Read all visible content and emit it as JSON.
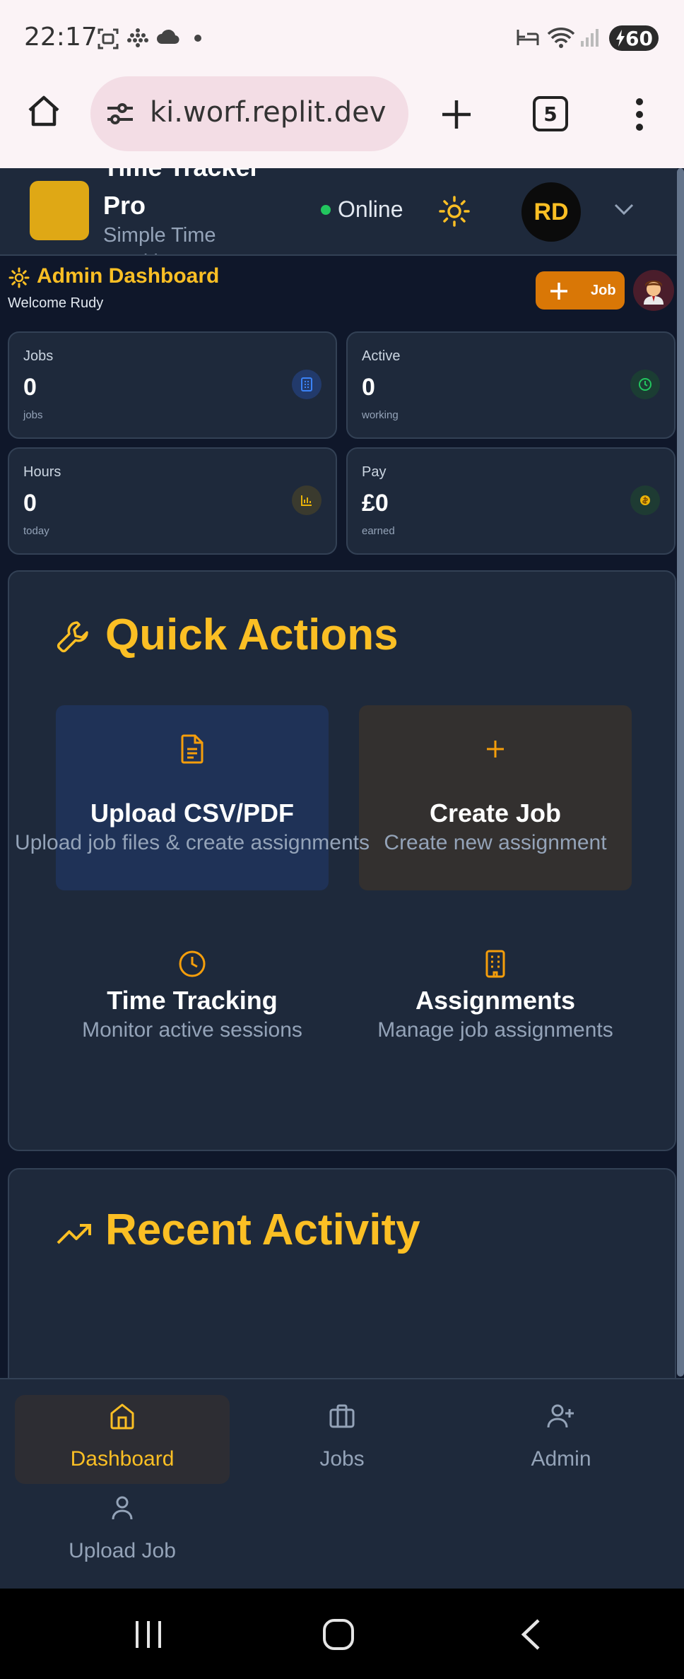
{
  "status_bar": {
    "time": "22:17",
    "battery": "60"
  },
  "browser": {
    "url": "ki.worf.replit.dev",
    "tab_count": "5"
  },
  "header": {
    "brand_title": "Time Tracker Pro",
    "brand_subtitle": "Simple Time Tracking",
    "status": "Online",
    "user_initials": "RD"
  },
  "dashboard": {
    "title": "Admin Dashboard",
    "welcome": "Welcome Rudy",
    "job_button": "Job"
  },
  "stats": [
    {
      "label": "Jobs",
      "value": "0",
      "unit": "jobs",
      "icon": "building-icon",
      "color": "#3b82f6"
    },
    {
      "label": "Active",
      "value": "0",
      "unit": "working",
      "icon": "clock-icon",
      "color": "#22c55e"
    },
    {
      "label": "Hours",
      "value": "0",
      "unit": "today",
      "icon": "bar-chart-icon",
      "color": "#eab308"
    },
    {
      "label": "Pay",
      "value": "£0",
      "unit": "earned",
      "icon": "coin-icon",
      "color": "#eab308"
    }
  ],
  "quick_actions": {
    "title": "Quick Actions",
    "items": [
      {
        "title": "Upload CSV/PDF",
        "desc": "Upload job files & create assignments",
        "icon": "file-icon"
      },
      {
        "title": "Create Job",
        "desc": "Create new assignment",
        "icon": "plus-icon"
      },
      {
        "title": "Time Tracking",
        "desc": "Monitor active sessions",
        "icon": "clock-icon"
      },
      {
        "title": "Assignments",
        "desc": "Manage job assignments",
        "icon": "building-icon"
      }
    ]
  },
  "recent_activity": {
    "title": "Recent Activity"
  },
  "bottom_nav": [
    {
      "label": "Dashboard",
      "icon": "home-icon",
      "active": true
    },
    {
      "label": "Jobs",
      "icon": "briefcase-icon",
      "active": false
    },
    {
      "label": "Admin",
      "icon": "user-plus-icon",
      "active": false
    },
    {
      "label": "Upload Job",
      "icon": "user-icon",
      "active": false
    }
  ],
  "colors": {
    "accent": "#fbbf24",
    "orange": "#d97706",
    "panel": "#1e293b",
    "background": "#0f172a"
  }
}
